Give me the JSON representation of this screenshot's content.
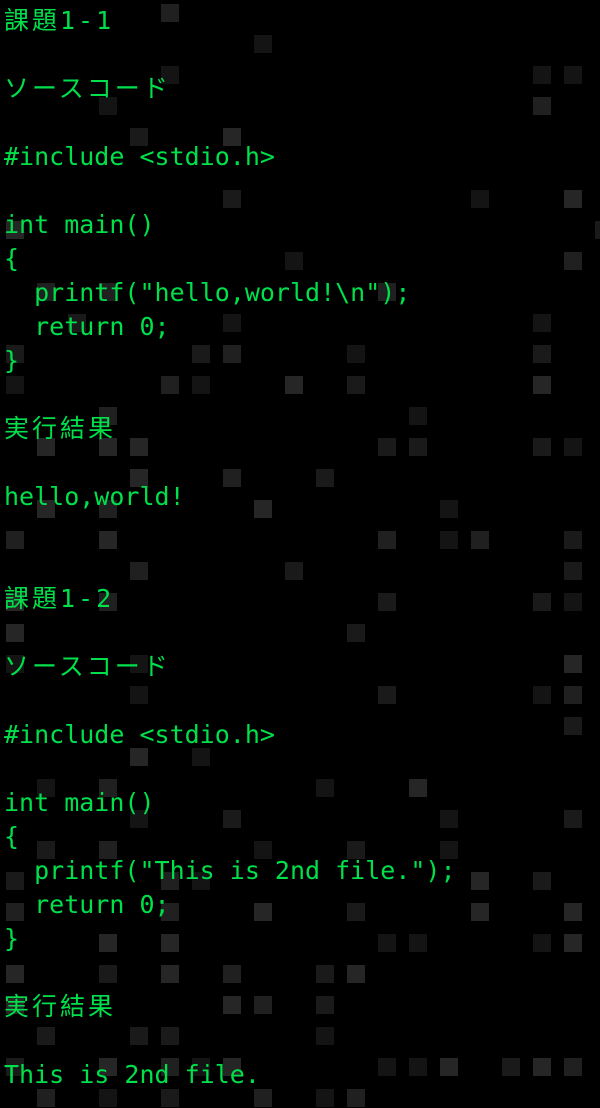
{
  "theme": {
    "background": "#000000",
    "text_color": "#00e04b",
    "tile_color": "#1b1b1b"
  },
  "terminal": {
    "sections": [
      {
        "title": "課題1-1",
        "source_heading": "ソースコード",
        "include": "#include <stdio.h>",
        "code": [
          "int main()",
          "{",
          "  printf(\"hello,world!\\n\");",
          "  return 0;",
          "}"
        ],
        "result_heading": "実行結果",
        "output": "hello,world!"
      },
      {
        "title": "課題1-2",
        "source_heading": "ソースコード",
        "include": "#include <stdio.h>",
        "code": [
          "int main()",
          "{",
          "  printf(\"This is 2nd file.\");",
          "  return 0;",
          "}"
        ],
        "result_heading": "実行結果",
        "output": "This is 2nd file."
      }
    ]
  }
}
